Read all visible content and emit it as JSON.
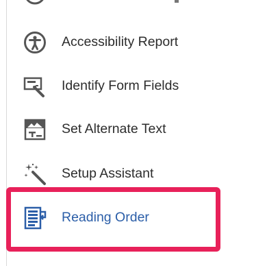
{
  "tools": [
    {
      "label": "Accessibility Report",
      "icon": "accessibility-icon"
    },
    {
      "label": "Identify Form Fields",
      "icon": "form-fields-icon"
    },
    {
      "label": "Set Alternate Text",
      "icon": "alt-text-icon"
    },
    {
      "label": "Setup Assistant",
      "icon": "magic-wand-icon"
    },
    {
      "label": "Reading Order",
      "icon": "reading-order-icon",
      "active": true
    }
  ],
  "colors": {
    "active_label": "#2b5ea8",
    "highlight_border": "#e8215a",
    "label": "#2c2c2c"
  }
}
